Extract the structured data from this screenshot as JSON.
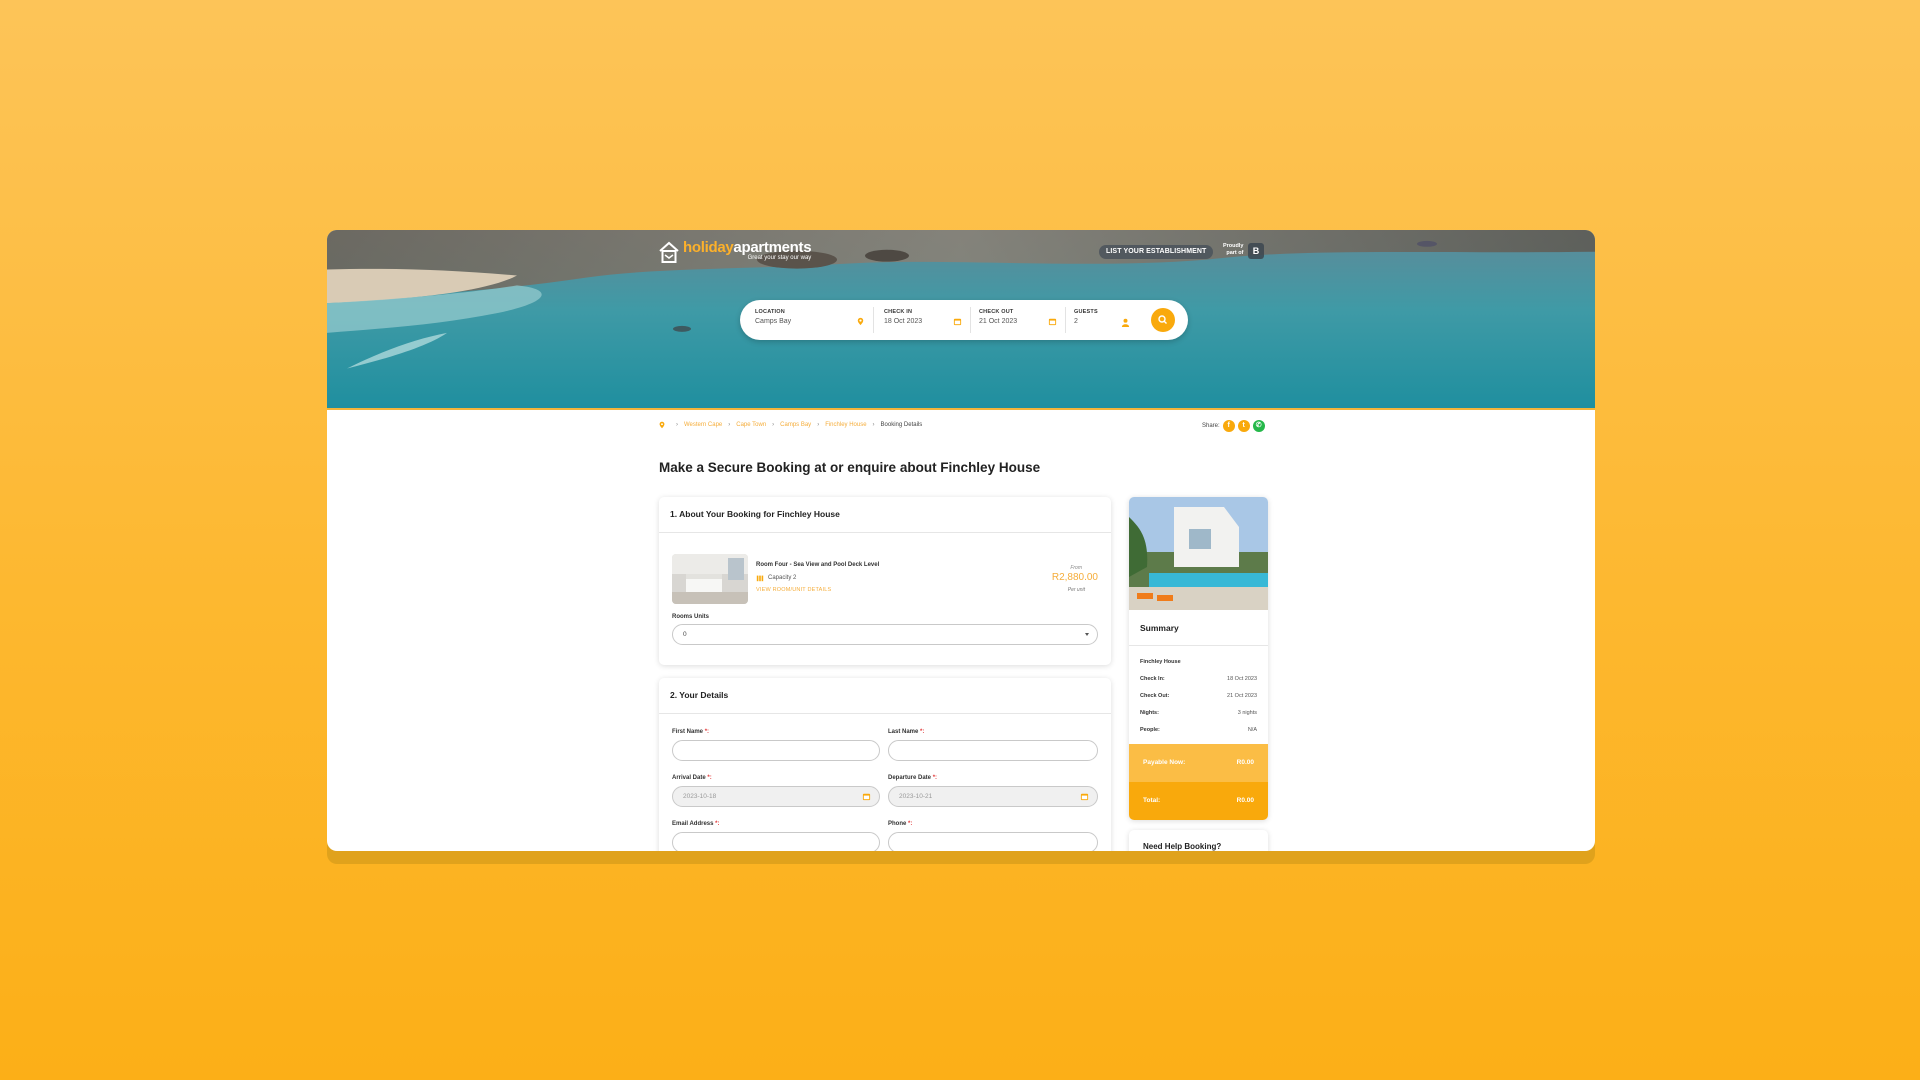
{
  "brand": {
    "name_part1": "holiday",
    "name_part2": "apartments",
    "tagline": "Great your stay our way"
  },
  "header": {
    "list_button": "LIST YOUR ESTABLISHMENT",
    "proudly_line1": "Proudly",
    "proudly_line2": "part of",
    "partner_badge": "B"
  },
  "search": {
    "location": {
      "label": "LOCATION",
      "value": "Camps Bay",
      "icon": "map-pin-icon"
    },
    "check_in": {
      "label": "CHECK IN",
      "value": "18 Oct 2023",
      "icon": "calendar-icon"
    },
    "check_out": {
      "label": "CHECK OUT",
      "value": "21 Oct 2023",
      "icon": "calendar-icon"
    },
    "guests": {
      "label": "GUESTS",
      "value": "2",
      "icon": "person-icon"
    },
    "button_icon": "search-icon"
  },
  "breadcrumb": {
    "items": [
      "Western Cape",
      "Cape Town",
      "Camps Bay",
      "Finchley House"
    ],
    "current": "Booking Details"
  },
  "share": {
    "label": "Share:",
    "networks": [
      "facebook-icon",
      "twitter-icon",
      "whatsapp-icon"
    ]
  },
  "page_title": "Make a Secure Booking at or enquire about Finchley House",
  "booking": {
    "section_title": "1. About Your Booking for Finchley House",
    "room": {
      "name": "Room Four - Sea View and Pool Deck Level",
      "capacity": "Capacity 2",
      "link": "VIEW ROOM/UNIT DETAILS",
      "price_from": "From",
      "price": "R2,880.00",
      "price_per": "Per unit"
    },
    "units_label": "Rooms Units",
    "units_value": "0"
  },
  "details": {
    "section_title": "2. Your Details",
    "first_name_label": "First Name",
    "last_name_label": "Last Name",
    "arrival_label": "Arrival Date",
    "arrival_value": "2023-10-18",
    "departure_label": "Departure Date",
    "departure_value": "2023-10-21",
    "email_label": "Email Address",
    "phone_label": "Phone",
    "required_mark": "*:"
  },
  "summary": {
    "title": "Summary",
    "property": "Finchley House",
    "rows": [
      {
        "k": "Check In:",
        "v": "18 Oct 2023"
      },
      {
        "k": "Check Out:",
        "v": "21 Oct 2023"
      },
      {
        "k": "Nights:",
        "v": "3 nights"
      },
      {
        "k": "People:",
        "v": "N/A"
      }
    ],
    "payable_label": "Payable Now:",
    "payable_value": "R0.00",
    "total_label": "Total:",
    "total_value": "R0.00"
  },
  "help": {
    "title": "Need Help Booking?"
  },
  "colors": {
    "accent": "#f9a90c",
    "accent_light": "#fbbd45",
    "link": "#f5ad3a",
    "background": "#fdb830"
  }
}
